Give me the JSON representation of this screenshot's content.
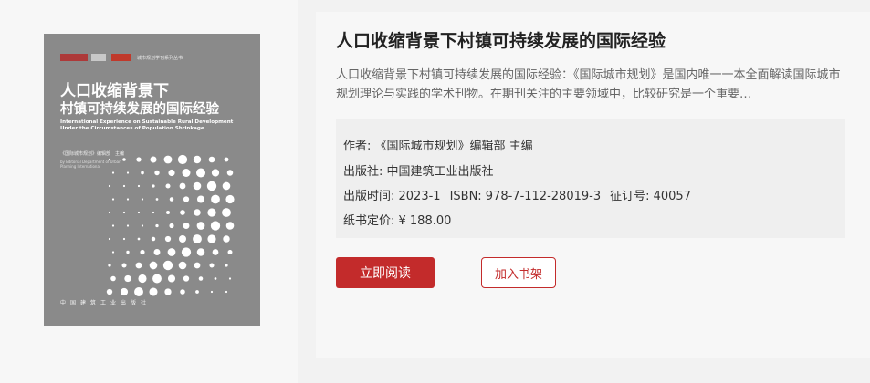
{
  "book": {
    "title": "人口收缩背景下村镇可持续发展的国际经验",
    "description": "人口收缩背景下村镇可持续发展的国际经验：《国际城市规划》是国内唯一一本全面解读国际城市规划理论与实践的学术刊物。在期刊关注的主要领域中，比较研究是一个重要…",
    "author": "作者: 《国际城市规划》编辑部 主编",
    "publisher": "出版社: 中国建筑工业出版社",
    "pub_time": "出版时间: 2023-1",
    "isbn": "ISBN: 978-7-112-28019-3",
    "order_no": "征订号: 40057",
    "price": "纸书定价: ¥ 188.00"
  },
  "cover": {
    "series": "城市规划学刊系列丛书",
    "title_line1": "人口收缩背景下",
    "title_line2": "村镇可持续发展的国际经验",
    "title_en": "International Experience on Sustainable Rural Development Under the Circumstances of Population Shrinkage",
    "editor": "《国际城市规划》编辑部　主编",
    "editor_en": "by Editorial Department of Urban Planning International",
    "publisher": "中国建筑工业出版社"
  },
  "actions": {
    "read_label": "立即阅读",
    "shelf_label": "加入书架"
  },
  "colors": {
    "accent": "#c32b2b",
    "cover_bg": "#8a8a8a",
    "page_bg": "#f2f2f2"
  }
}
